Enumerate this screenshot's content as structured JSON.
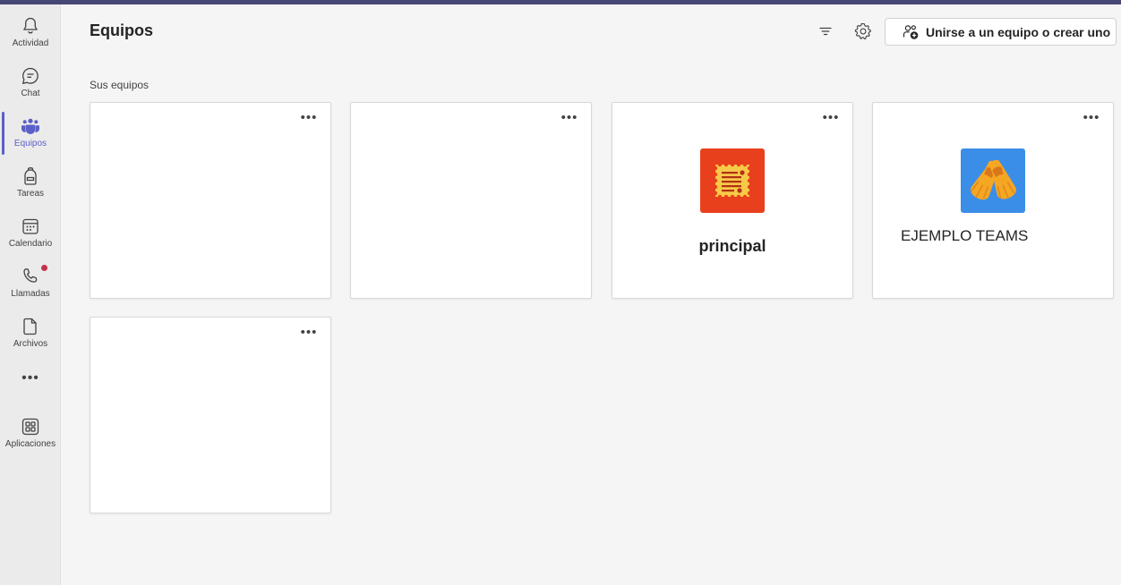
{
  "colors": {
    "accent": "#5b5fc7",
    "topbar": "#464775",
    "rail_bg": "#ebebeb",
    "content_bg": "#f5f5f5",
    "badge": "#c4314b",
    "principal_avatar_bg": "#e8401c",
    "ejemplo_avatar_bg": "#3b8ee8"
  },
  "rail": {
    "items": [
      {
        "label": "Actividad",
        "icon": "bell-icon"
      },
      {
        "label": "Chat",
        "icon": "chat-icon"
      },
      {
        "label": "Equipos",
        "icon": "teams-icon",
        "active": true
      },
      {
        "label": "Tareas",
        "icon": "backpack-icon"
      },
      {
        "label": "Calendario",
        "icon": "calendar-icon"
      },
      {
        "label": "Llamadas",
        "icon": "phone-icon",
        "badge": true
      },
      {
        "label": "Archivos",
        "icon": "file-icon"
      },
      {
        "label": "Aplicaciones",
        "icon": "apps-icon"
      }
    ],
    "more_label": "•••"
  },
  "header": {
    "title": "Equipos",
    "filter_icon": "filter-icon",
    "settings_icon": "gear-icon",
    "join_button_label": "Unirse a un equipo o crear uno",
    "join_button_icon": "people-add-icon"
  },
  "section": {
    "label": "Sus equipos"
  },
  "teams": [
    {
      "name": "",
      "more": "•••"
    },
    {
      "name": "",
      "more": "•••"
    },
    {
      "name": "principal",
      "more": "•••",
      "avatar_icon": "document-stamp-icon"
    },
    {
      "name": "EJEMPLO TEAMS",
      "more": "•••",
      "avatar_icon": "swim-fins-icon"
    },
    {
      "name": "",
      "more": "•••"
    }
  ]
}
